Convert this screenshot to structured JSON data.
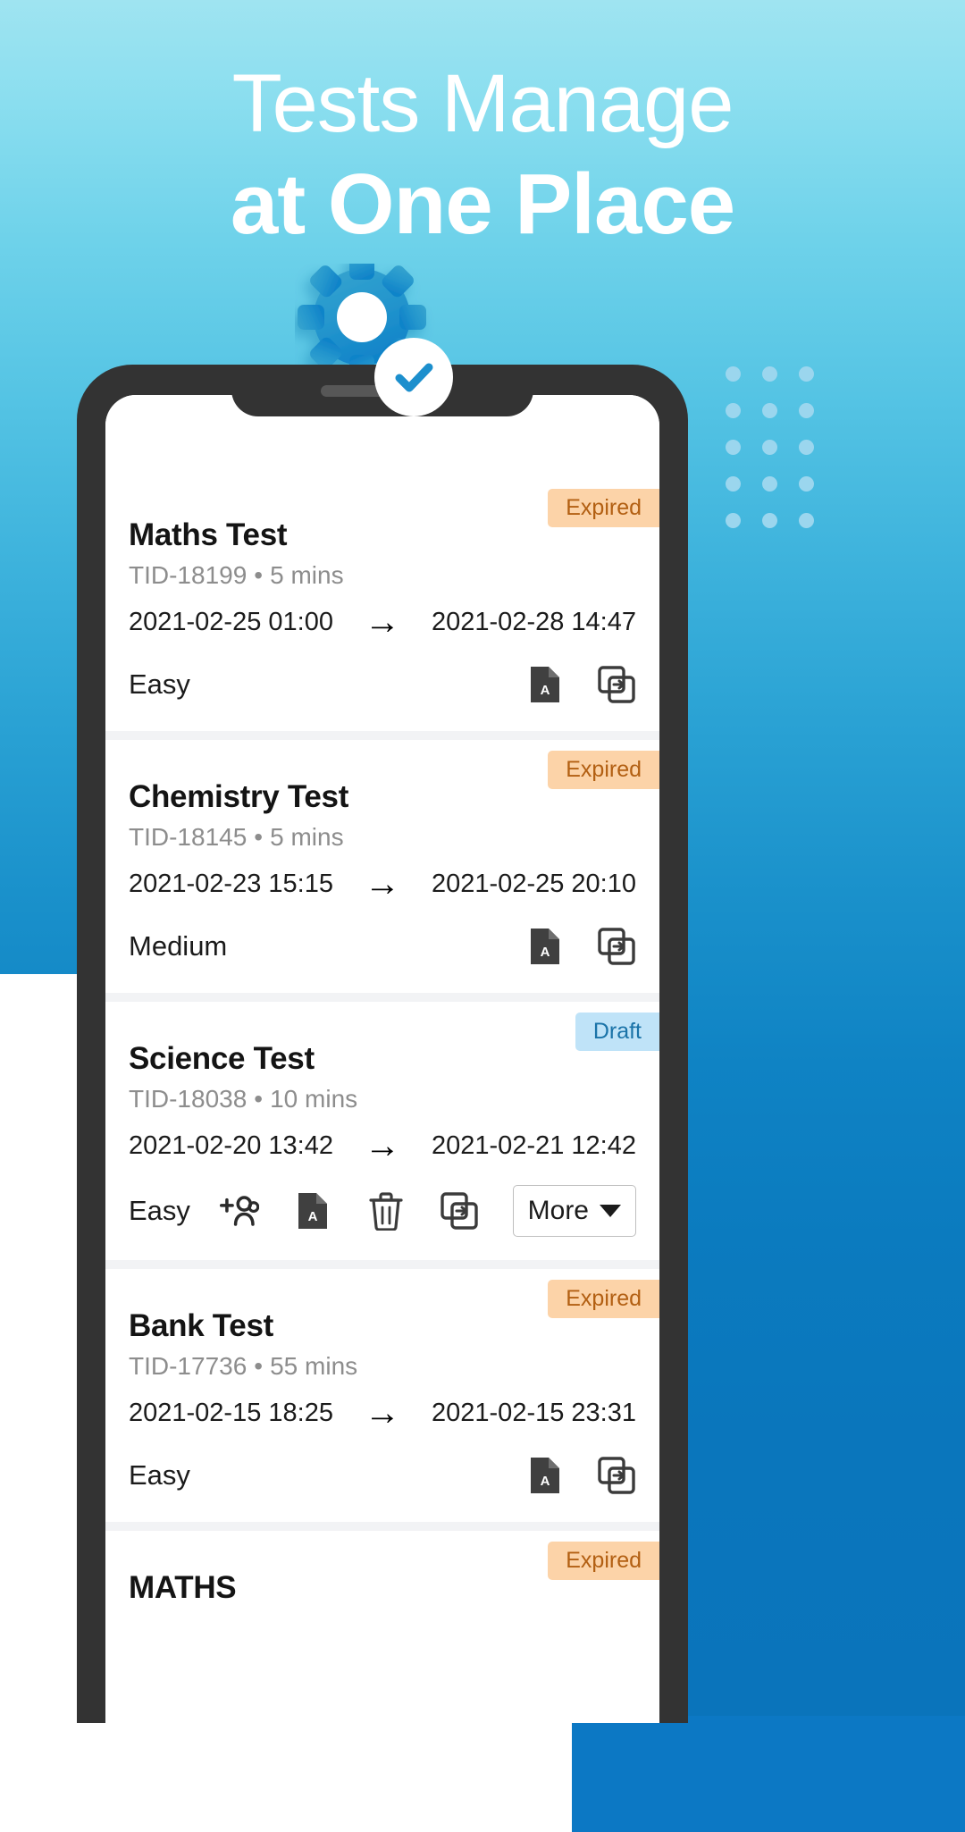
{
  "headline": {
    "line1": "Tests Manage",
    "line2": "at One Place"
  },
  "colors": {
    "accent_blue": "#1c8fcd",
    "gradient_top": "#9fe4f1",
    "gradient_bottom": "#0a74bb",
    "badge_expired_bg": "#fcd3a8",
    "badge_expired_text": "#b25f12",
    "badge_draft_bg": "#bfe3f8",
    "badge_draft_text": "#1a73a8",
    "phone_frame": "#333333",
    "dot_color": "#9bd6ee"
  },
  "hero": {
    "gear_icon": "gear-icon",
    "check_icon": "check-circle-icon"
  },
  "phone": {
    "notch_speaker": "speaker-icon",
    "notch_camera": "camera-icon"
  },
  "tests": [
    {
      "title": "Maths Test",
      "tid": "TID-18199",
      "duration": "5 mins",
      "start": "2021-02-25 01:00",
      "end": "2021-02-28 14:47",
      "arrow": "→",
      "difficulty": "Easy",
      "status": "Expired",
      "status_type": "expired",
      "actions": [
        "pdf-icon",
        "duplicate-icon"
      ]
    },
    {
      "title": "Chemistry Test",
      "tid": "TID-18145",
      "duration": "5 mins",
      "start": "2021-02-23 15:15",
      "end": "2021-02-25 20:10",
      "arrow": "→",
      "difficulty": "Medium",
      "status": "Expired",
      "status_type": "expired",
      "actions": [
        "pdf-icon",
        "duplicate-icon"
      ]
    },
    {
      "title": "Science Test",
      "tid": "TID-18038",
      "duration": "10 mins",
      "start": "2021-02-20 13:42",
      "end": "2021-02-21 12:42",
      "arrow": "→",
      "difficulty": "Easy",
      "status": "Draft",
      "status_type": "draft",
      "actions": [
        "add-people-icon",
        "pdf-icon",
        "delete-icon",
        "duplicate-icon"
      ],
      "more_label": "More"
    },
    {
      "title": "Bank Test",
      "tid": "TID-17736",
      "duration": "55 mins",
      "start": "2021-02-15 18:25",
      "end": "2021-02-15 23:31",
      "arrow": "→",
      "difficulty": "Easy",
      "status": "Expired",
      "status_type": "expired",
      "actions": [
        "pdf-icon",
        "duplicate-icon"
      ]
    },
    {
      "title": "MATHS",
      "tid": "",
      "duration": "",
      "start": "",
      "end": "",
      "arrow": "→",
      "difficulty": "",
      "status": "Expired",
      "status_type": "expired",
      "actions": []
    }
  ]
}
